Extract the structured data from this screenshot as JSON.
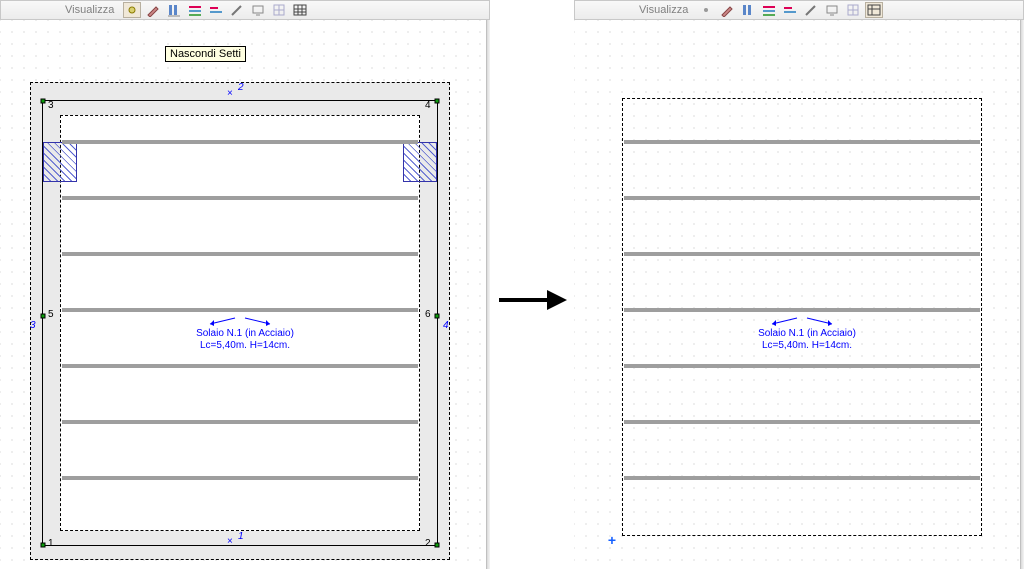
{
  "toolbar_label": "Visualizza",
  "tooltip": "Nascondi Setti",
  "annotation_line1": "Solaio N.1 (in Acciaio)",
  "annotation_line2": "Lc=5,40m. H=14cm.",
  "nodes": {
    "n1": "1",
    "n2": "2",
    "n3": "3",
    "n4": "4",
    "n5": "5",
    "n6": "6"
  },
  "edges": {
    "top": "2",
    "bottom": "1",
    "left": "3",
    "right": "4"
  },
  "icons": {
    "highlight": "highlight-icon",
    "pencil": "pencil-icon",
    "align": "align-icon",
    "beams": "beams-icon",
    "beams2": "beams2-icon",
    "pencil2": "pencil2-icon",
    "monitor": "monitor-icon",
    "grid": "grid-icon",
    "table": "table-icon"
  }
}
